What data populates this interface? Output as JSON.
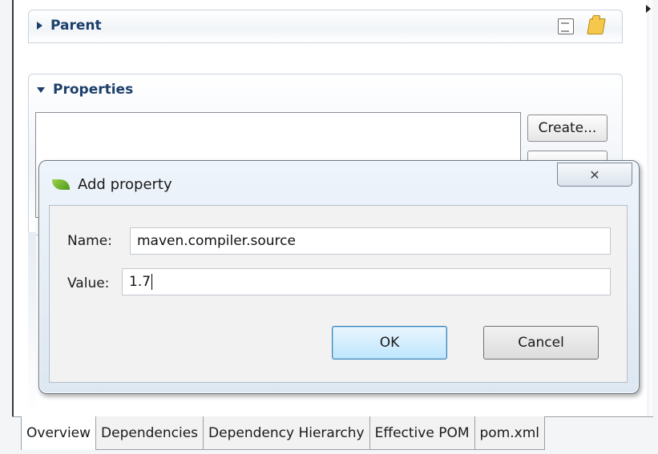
{
  "sections": {
    "parent": {
      "title": "Parent"
    },
    "properties": {
      "title": "Properties",
      "create_label": "Create..."
    }
  },
  "dialog": {
    "title": "Add property",
    "close_glyph": "✕",
    "name_label": "Name:",
    "name_value": "maven.compiler.source",
    "value_label": "Value:",
    "value_value": "1.7",
    "ok_label": "OK",
    "cancel_label": "Cancel"
  },
  "tabs": [
    {
      "label": "Overview",
      "active": true
    },
    {
      "label": "Dependencies"
    },
    {
      "label": "Dependency Hierarchy"
    },
    {
      "label": "Effective POM"
    },
    {
      "label": "pom.xml"
    }
  ],
  "icons": {
    "parent_actions": [
      "pom-icon",
      "open-folder-icon"
    ],
    "dialog": "spring-leaf-icon"
  }
}
